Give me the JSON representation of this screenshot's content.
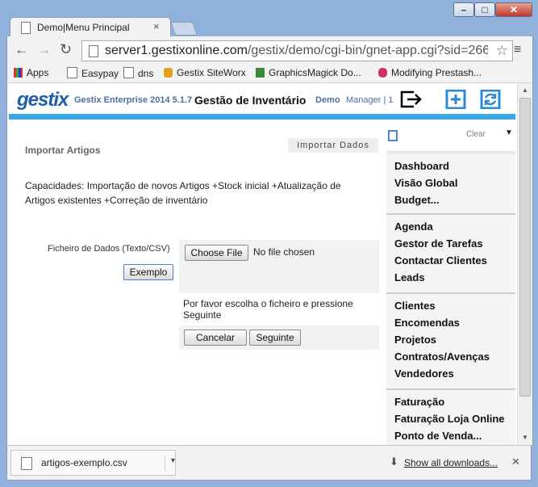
{
  "browser": {
    "tab_title": "Demo|Menu Principal",
    "url_host": "server1.gestixonline.com",
    "url_path": "/gestix/demo/cgi-bin/gnet-app.cgi?sid=266",
    "bookmarks": [
      "Apps",
      "Easypay",
      "dns",
      "Gestix SiteWorx",
      "GraphicsMagick Do...",
      "Modifying Prestash..."
    ]
  },
  "header": {
    "logo": "gestix",
    "product": "Gestix Enterprise 2014 5.1.7",
    "module": "Gestão de Inventário",
    "company": "Demo",
    "user": "Manager | 1"
  },
  "content": {
    "page_title": "Importar Artigos",
    "tag": "Importar Dados",
    "capabilities": "Capacidades: Importação de novos Artigos +Stock inicial +Atualização de Artigos existentes +Correção de inventário",
    "file_label": "Ficheiro de Dados (Texto/CSV)",
    "example_btn": "Exemplo",
    "choose_btn": "Choose File",
    "no_file": "No file chosen",
    "hint": "Por favor escolha o ficheiro e pressione Seguinte",
    "cancel_btn": "Cancelar",
    "next_btn": "Seguinte"
  },
  "sidebar": {
    "clear": "Clear",
    "groups": [
      [
        "Dashboard",
        "Visão Global",
        "Budget..."
      ],
      [
        "Agenda",
        "Gestor de Tarefas",
        "Contactar Clientes",
        "Leads"
      ],
      [
        "Clientes",
        "Encomendas",
        "Projetos",
        "Contratos/Avenças",
        "Vendedores"
      ],
      [
        "Faturação",
        "Faturação Loja Online",
        "Ponto de Venda..."
      ]
    ]
  },
  "downloads": {
    "file": "artigos-exemplo.csv",
    "show_all": "Show all downloads..."
  }
}
